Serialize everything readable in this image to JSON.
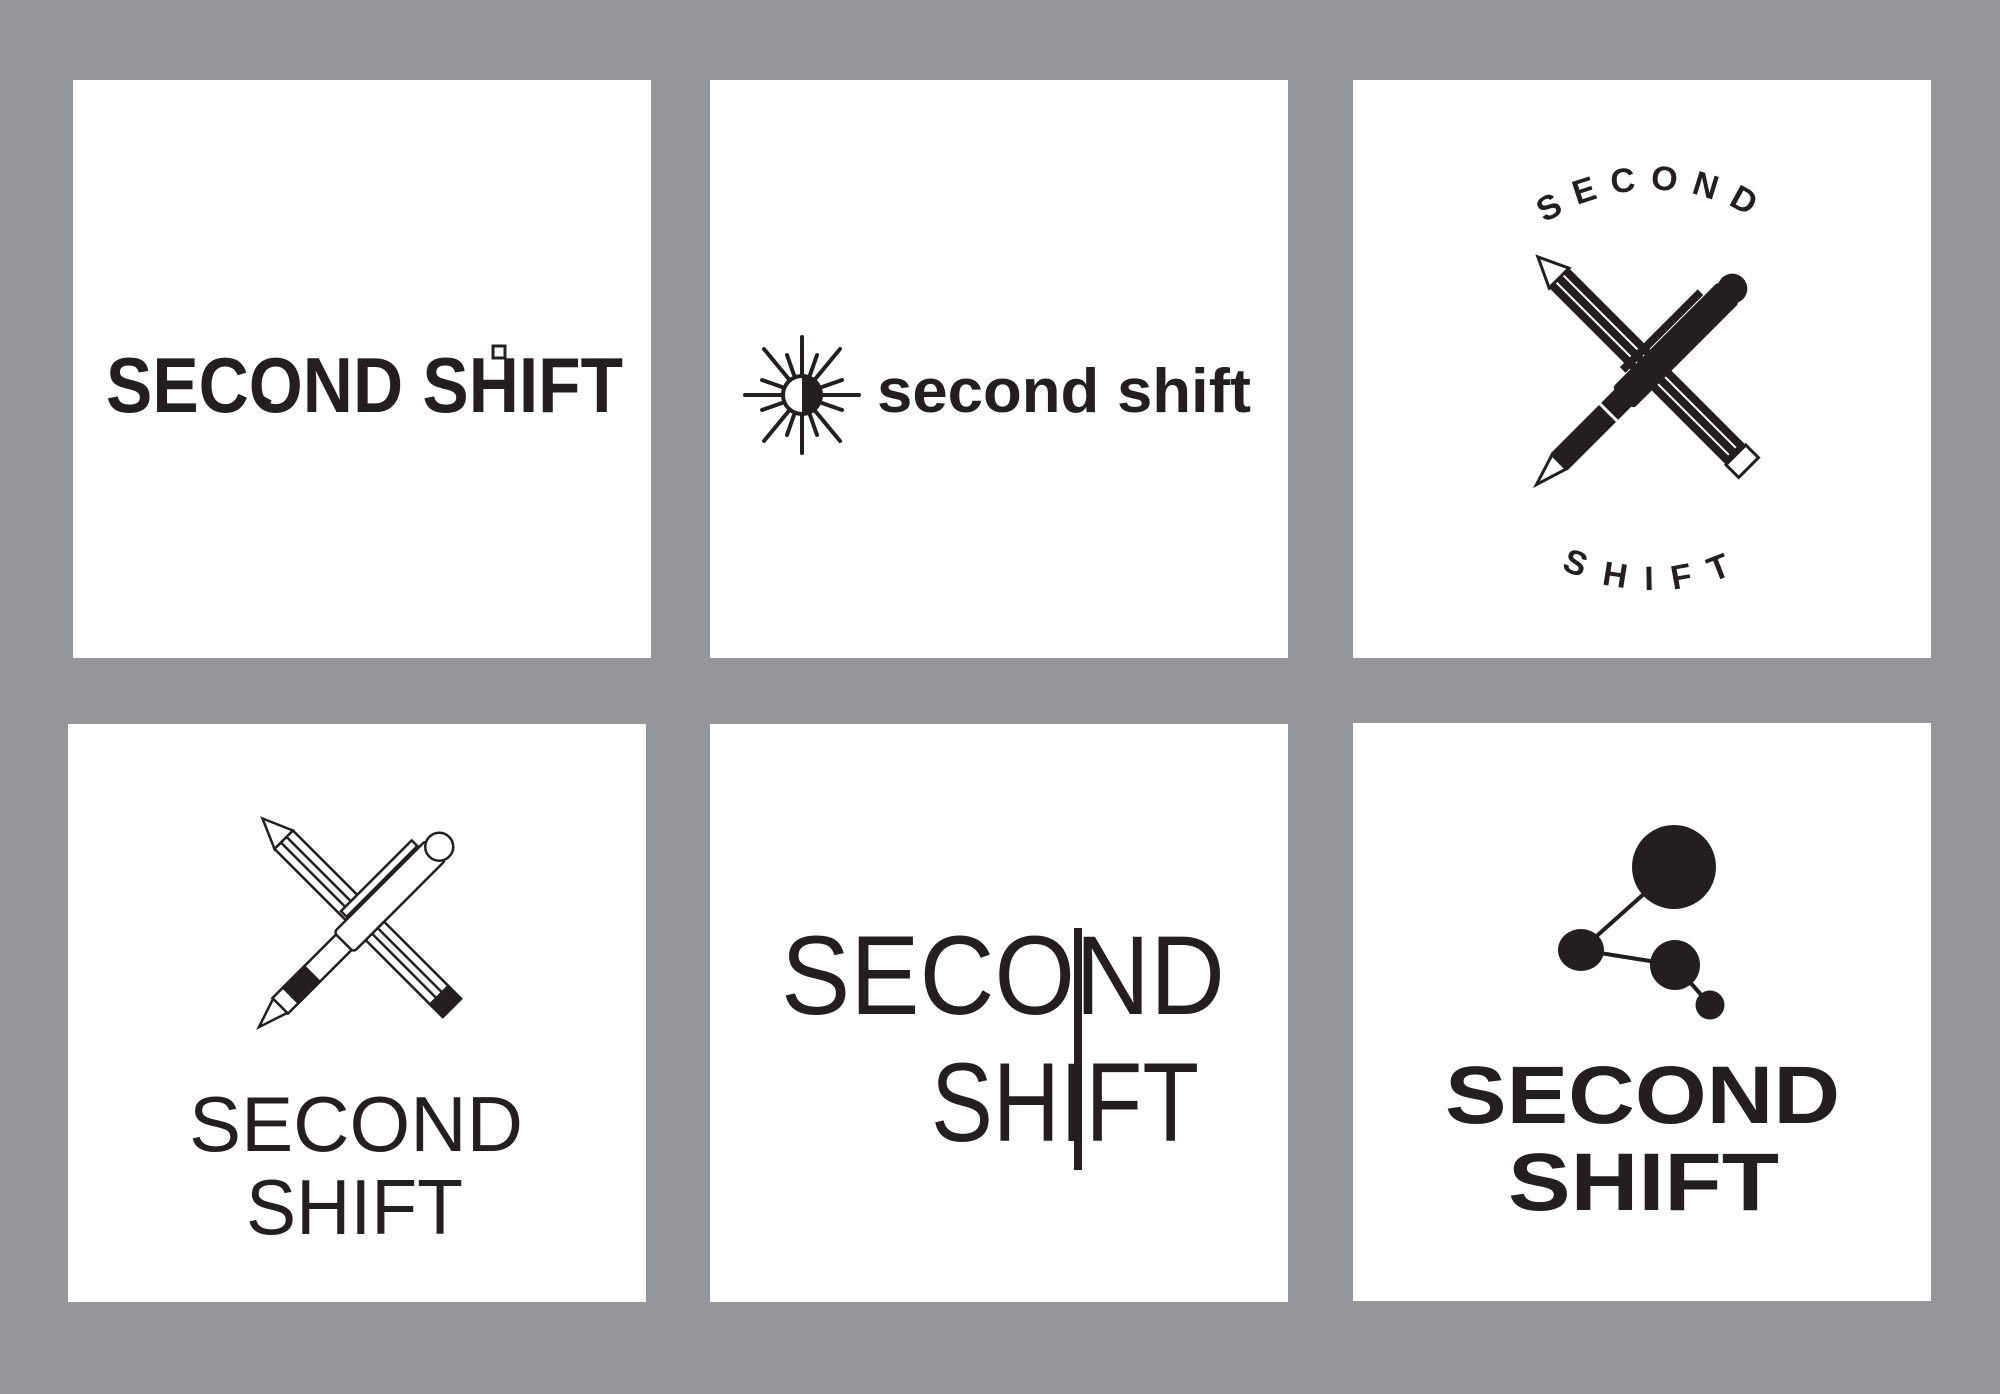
{
  "colors": {
    "background": "#95969a",
    "panel": "#ffffff",
    "ink": "#231f20"
  },
  "logos": [
    {
      "id": "clock-pencil",
      "text": "SECOND SHIFT"
    },
    {
      "id": "sun",
      "text": "second shift"
    },
    {
      "id": "crossed-pens-badge",
      "top": "SECOND",
      "bottom": "SHIFT"
    },
    {
      "id": "crossed-pens-outline",
      "line1": "SECOND",
      "line2": "SHIFT"
    },
    {
      "id": "stem-n",
      "line1": "SECOND",
      "line2": "SHIFT"
    },
    {
      "id": "molecule",
      "line1": "SECOND",
      "line2": "SHIFT"
    }
  ]
}
